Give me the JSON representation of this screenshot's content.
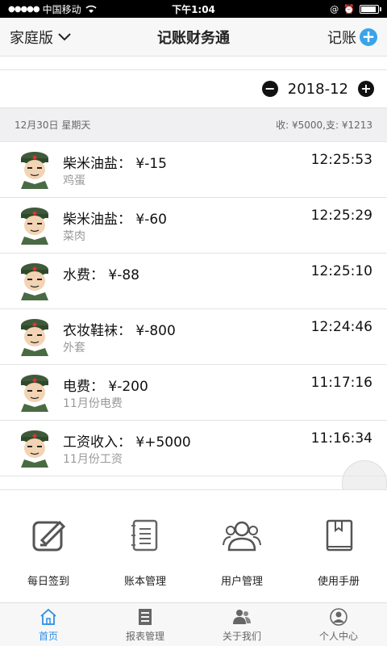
{
  "status_bar": {
    "carrier": "中国移动",
    "time": "下午1:04"
  },
  "nav": {
    "left_label": "家庭版",
    "title": "记账财务通",
    "right_label": "记账",
    "accent": "#3aa4e8"
  },
  "month": {
    "value": "2018-12"
  },
  "day": {
    "date": "12月30日 星期天",
    "summary": "收: ¥5000,支: ¥1213"
  },
  "entries": [
    {
      "title": "柴米油盐： ¥-15",
      "note": "鸡蛋",
      "time": "12:25:53"
    },
    {
      "title": "柴米油盐： ¥-60",
      "note": "菜肉",
      "time": "12:25:29"
    },
    {
      "title": "水费： ¥-88",
      "note": "",
      "time": "12:25:10"
    },
    {
      "title": "衣妆鞋袜： ¥-800",
      "note": "外套",
      "time": "12:24:46"
    },
    {
      "title": "电费： ¥-200",
      "note": "11月份电费",
      "time": "11:17:16"
    },
    {
      "title": "工资收入： ¥+5000",
      "note": "11月份工资",
      "time": "11:16:34"
    }
  ],
  "panel": [
    {
      "label": "每日签到",
      "icon": "edit-icon"
    },
    {
      "label": "账本管理",
      "icon": "notebook-icon"
    },
    {
      "label": "用户管理",
      "icon": "users-icon"
    },
    {
      "label": "使用手册",
      "icon": "book-icon"
    }
  ],
  "tabs": [
    {
      "label": "首页",
      "icon": "home-icon",
      "active": true
    },
    {
      "label": "报表管理",
      "icon": "report-icon"
    },
    {
      "label": "关于我们",
      "icon": "people-icon"
    },
    {
      "label": "个人中心",
      "icon": "person-icon"
    }
  ]
}
